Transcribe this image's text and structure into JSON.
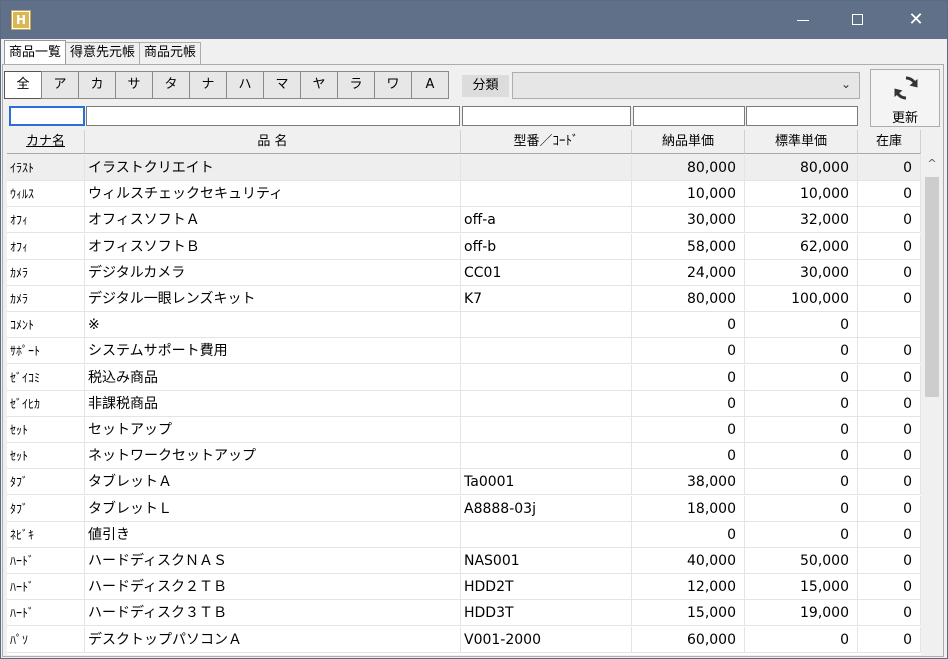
{
  "window": {
    "icon_label": "H",
    "minimize": "",
    "maximize": "",
    "close": "✕"
  },
  "tabs": [
    "商品一覧",
    "得意先元帳",
    "商品元帳"
  ],
  "kana_buttons": [
    "全",
    "ア",
    "カ",
    "サ",
    "タ",
    "ナ",
    "ハ",
    "マ",
    "ヤ",
    "ラ",
    "ワ",
    "A"
  ],
  "filter_bar": {
    "bunrui_label": "分類",
    "bunrui_value": "",
    "refresh_label": "更新"
  },
  "columns": [
    "カナ名",
    "品 名",
    "型番／ｺｰﾄﾞ",
    "納品単価",
    "標準単価",
    "在庫"
  ],
  "rows": [
    {
      "kana": "ｲﾗｽﾄ",
      "name": "イラストクリエイト",
      "code": "",
      "nohin": "80,000",
      "hyojun": "80,000",
      "zaiko": "0"
    },
    {
      "kana": "ｳｨﾙｽ",
      "name": "ウィルスチェックセキュリティ",
      "code": "",
      "nohin": "10,000",
      "hyojun": "10,000",
      "zaiko": "0"
    },
    {
      "kana": "ｵﾌｨ",
      "name": "オフィスソフトＡ",
      "code": "off-a",
      "nohin": "30,000",
      "hyojun": "32,000",
      "zaiko": "0"
    },
    {
      "kana": "ｵﾌｨ",
      "name": "オフィスソフトＢ",
      "code": "off-b",
      "nohin": "58,000",
      "hyojun": "62,000",
      "zaiko": "0"
    },
    {
      "kana": "ｶﾒﾗ",
      "name": "デジタルカメラ",
      "code": "CC01",
      "nohin": "24,000",
      "hyojun": "30,000",
      "zaiko": "0"
    },
    {
      "kana": "ｶﾒﾗ",
      "name": "デジタル一眼レンズキット",
      "code": "K7",
      "nohin": "80,000",
      "hyojun": "100,000",
      "zaiko": "0"
    },
    {
      "kana": "ｺﾒﾝﾄ",
      "name": "※",
      "code": "",
      "nohin": "0",
      "hyojun": "0",
      "zaiko": ""
    },
    {
      "kana": "ｻﾎﾟｰﾄ",
      "name": "システムサポート費用",
      "code": "",
      "nohin": "0",
      "hyojun": "0",
      "zaiko": "0"
    },
    {
      "kana": "ｾﾞｲｺﾐ",
      "name": "税込み商品",
      "code": "",
      "nohin": "0",
      "hyojun": "0",
      "zaiko": "0"
    },
    {
      "kana": "ｾﾞｲﾋｶ",
      "name": "非課税商品",
      "code": "",
      "nohin": "0",
      "hyojun": "0",
      "zaiko": "0"
    },
    {
      "kana": "ｾｯﾄ",
      "name": "セットアップ",
      "code": "",
      "nohin": "0",
      "hyojun": "0",
      "zaiko": "0"
    },
    {
      "kana": "ｾｯﾄ",
      "name": "ネットワークセットアップ",
      "code": "",
      "nohin": "0",
      "hyojun": "0",
      "zaiko": "0"
    },
    {
      "kana": "ﾀﾌﾞ",
      "name": "タブレットＡ",
      "code": "Ta0001",
      "nohin": "38,000",
      "hyojun": "0",
      "zaiko": "0"
    },
    {
      "kana": "ﾀﾌﾞ",
      "name": "タブレットＬ",
      "code": "A8888-03j",
      "nohin": "18,000",
      "hyojun": "0",
      "zaiko": "0"
    },
    {
      "kana": "ﾈﾋﾞｷ",
      "name": "値引き",
      "code": "",
      "nohin": "0",
      "hyojun": "0",
      "zaiko": "0"
    },
    {
      "kana": "ﾊｰﾄﾞ",
      "name": "ハードディスクＮＡＳ",
      "code": "NAS001",
      "nohin": "40,000",
      "hyojun": "50,000",
      "zaiko": "0"
    },
    {
      "kana": "ﾊｰﾄﾞ",
      "name": "ハードディスク２ＴＢ",
      "code": "HDD2T",
      "nohin": "12,000",
      "hyojun": "15,000",
      "zaiko": "0"
    },
    {
      "kana": "ﾊｰﾄﾞ",
      "name": "ハードディスク３ＴＢ",
      "code": "HDD3T",
      "nohin": "15,000",
      "hyojun": "19,000",
      "zaiko": "0"
    },
    {
      "kana": "ﾊﾟｿ",
      "name": "デスクトップパソコンＡ",
      "code": "V001-2000",
      "nohin": "60,000",
      "hyojun": "0",
      "zaiko": "0"
    }
  ],
  "scrollbar": {
    "up_arrow": "^"
  }
}
